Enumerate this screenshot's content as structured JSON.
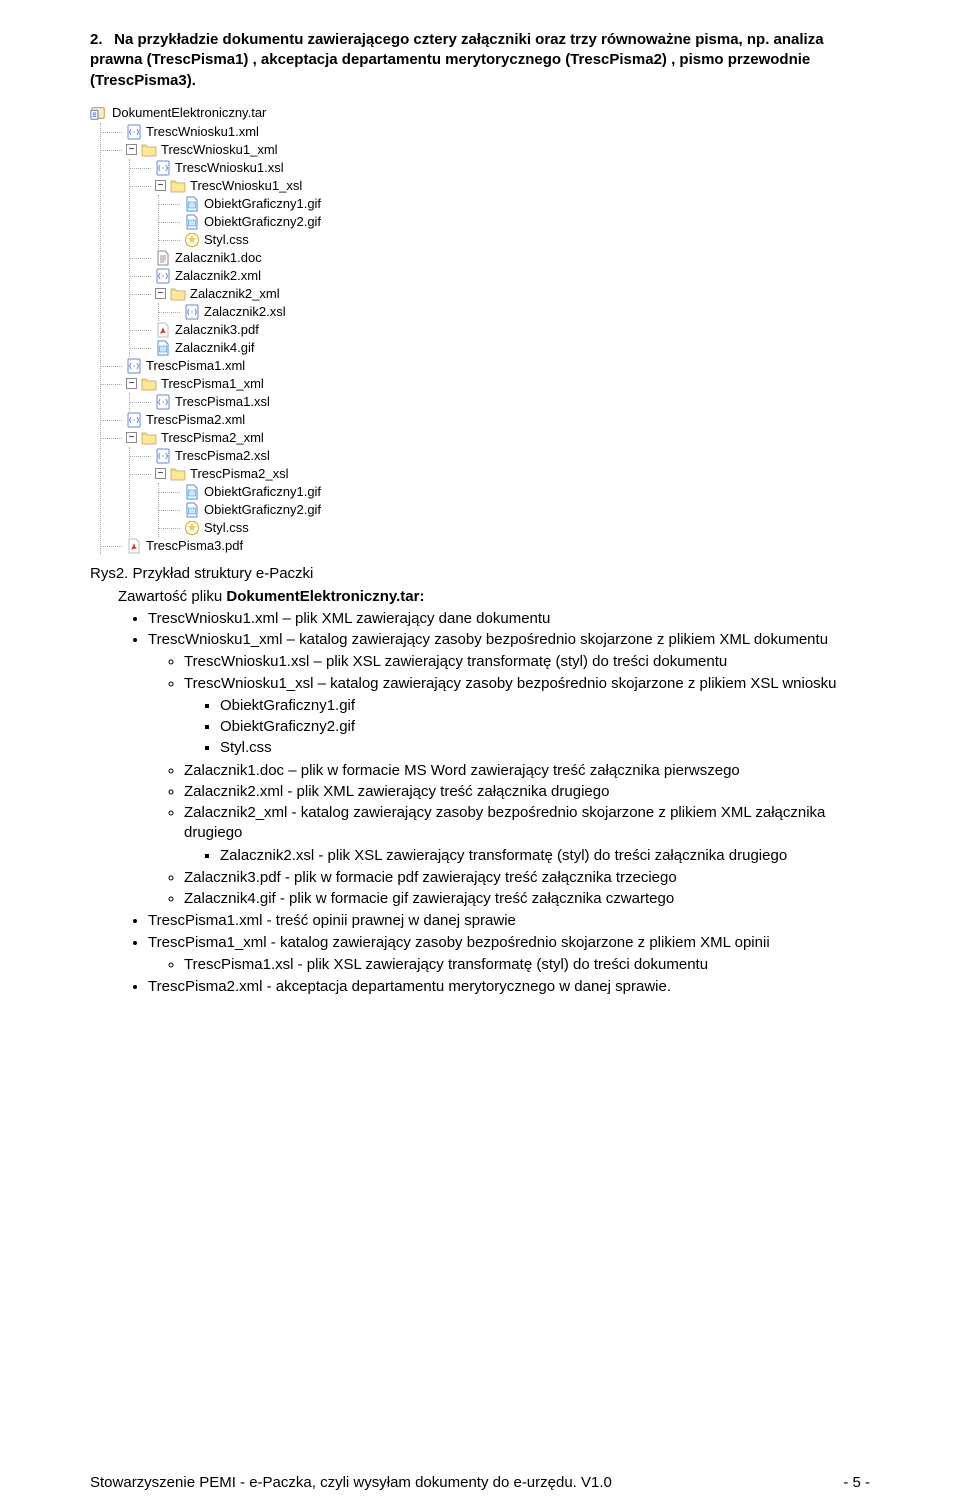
{
  "heading": {
    "number": "2.",
    "text": "Na przykładzie dokumentu zawierającego cztery załączniki oraz trzy równoważne pisma, np. analiza prawna (TrescPisma1) , akceptacja departamentu merytorycznego (TrescPisma2) , pismo przewodnie (TrescPisma3)."
  },
  "tree": {
    "root": "DokumentElektroniczny.tar",
    "items": [
      {
        "icon": "xml",
        "label": "TrescWniosku1.xml"
      },
      {
        "icon": "folder",
        "label": "TrescWniosku1_xml",
        "expanded": true,
        "children": [
          {
            "icon": "xml",
            "label": "TrescWniosku1.xsl"
          },
          {
            "icon": "folder",
            "label": "TrescWniosku1_xsl",
            "expanded": true,
            "children": [
              {
                "icon": "gif",
                "label": "ObiektGraficzny1.gif"
              },
              {
                "icon": "gif",
                "label": "ObiektGraficzny2.gif"
              },
              {
                "icon": "css",
                "label": "Styl.css"
              }
            ]
          },
          {
            "icon": "doc",
            "label": "Zalacznik1.doc"
          },
          {
            "icon": "xml",
            "label": "Zalacznik2.xml"
          },
          {
            "icon": "folder",
            "label": "Zalacznik2_xml",
            "expanded": true,
            "children": [
              {
                "icon": "xml",
                "label": "Zalacznik2.xsl"
              }
            ]
          },
          {
            "icon": "pdf",
            "label": "Zalacznik3.pdf"
          },
          {
            "icon": "gif",
            "label": "Zalacznik4.gif"
          }
        ]
      },
      {
        "icon": "xml",
        "label": "TrescPisma1.xml"
      },
      {
        "icon": "folder",
        "label": "TrescPisma1_xml",
        "expanded": true,
        "children": [
          {
            "icon": "xml",
            "label": "TrescPisma1.xsl"
          }
        ]
      },
      {
        "icon": "xml",
        "label": "TrescPisma2.xml"
      },
      {
        "icon": "folder",
        "label": "TrescPisma2_xml",
        "expanded": true,
        "children": [
          {
            "icon": "xml",
            "label": "TrescPisma2.xsl"
          },
          {
            "icon": "folder",
            "label": "TrescPisma2_xsl",
            "expanded": true,
            "children": [
              {
                "icon": "gif",
                "label": "ObiektGraficzny1.gif"
              },
              {
                "icon": "gif",
                "label": "ObiektGraficzny2.gif"
              },
              {
                "icon": "css",
                "label": "Styl.css"
              }
            ]
          }
        ]
      },
      {
        "icon": "pdf",
        "label": "TrescPisma3.pdf"
      }
    ]
  },
  "caption": "Rys2. Przykład struktury e-Paczki",
  "subhead": {
    "pre": "Zawartość pliku ",
    "bold": "DokumentElektroniczny.tar:"
  },
  "content": [
    {
      "t": "li1",
      "text": "TrescWniosku1.xml – plik XML zawierający dane dokumentu"
    },
    {
      "t": "li1",
      "text": "TrescWniosku1_xml – katalog zawierający zasoby bezpośrednio skojarzone z plikiem XML dokumentu"
    },
    {
      "t": "li2",
      "text": "TrescWniosku1.xsl – plik XSL zawierający transformatę (styl) do treści dokumentu"
    },
    {
      "t": "li2",
      "text": "TrescWniosku1_xsl – katalog zawierający zasoby bezpośrednio skojarzone z plikiem XSL wniosku"
    },
    {
      "t": "li3",
      "text": "ObiektGraficzny1.gif"
    },
    {
      "t": "li3",
      "text": "ObiektGraficzny2.gif"
    },
    {
      "t": "li3",
      "text": "Styl.css"
    },
    {
      "t": "li2",
      "text": "Zalacznik1.doc – plik w formacie MS Word zawierający treść załącznika pierwszego"
    },
    {
      "t": "li2",
      "text": "Zalacznik2.xml - plik XML zawierający treść  załącznika drugiego"
    },
    {
      "t": "li2",
      "text": "Zalacznik2_xml - katalog zawierający zasoby bezpośrednio skojarzone z plikiem XML załącznika drugiego"
    },
    {
      "t": "li3",
      "text": "Zalacznik2.xsl - plik XSL zawierający transformatę (styl) do treści załącznika drugiego"
    },
    {
      "t": "li2",
      "text": "Zalacznik3.pdf - plik w formacie pdf zawierający treść załącznika trzeciego"
    },
    {
      "t": "li2",
      "text": "Zalacznik4.gif - plik w formacie gif zawierający treść załącznika czwartego"
    },
    {
      "t": "li1",
      "text": "TrescPisma1.xml - treść opinii prawnej w danej sprawie"
    },
    {
      "t": "li1",
      "text": "TrescPisma1_xml - katalog zawierający zasoby bezpośrednio skojarzone z plikiem XML opinii"
    },
    {
      "t": "li2",
      "text": "TrescPisma1.xsl - plik XSL zawierający transformatę (styl) do treści dokumentu"
    },
    {
      "t": "li1",
      "text": "TrescPisma2.xml - akceptacja departamentu merytorycznego w danej sprawie."
    }
  ],
  "footer": {
    "left": "Stowarzyszenie PEMI - e-Paczka, czyli wysyłam dokumenty do e-urzędu. V1.0",
    "right": "- 5 -"
  },
  "icon_colors": {
    "xml_bg": "#fff",
    "xml_border": "#6b89c7",
    "xml_dot": "#6b89c7",
    "folder_bg": "#ffe79a",
    "folder_border": "#c2a24a",
    "gif_bg": "#fff",
    "gif_border": "#4a90d9",
    "css_star": "#f7c948",
    "doc_bg": "#fff",
    "doc_border": "#888",
    "pdf_bg": "#fff",
    "pdf_red": "#d03a2b",
    "archive_bg": "#fdebc8",
    "archive_border": "#c78b2e",
    "archive_blue": "#3b6fbf"
  }
}
